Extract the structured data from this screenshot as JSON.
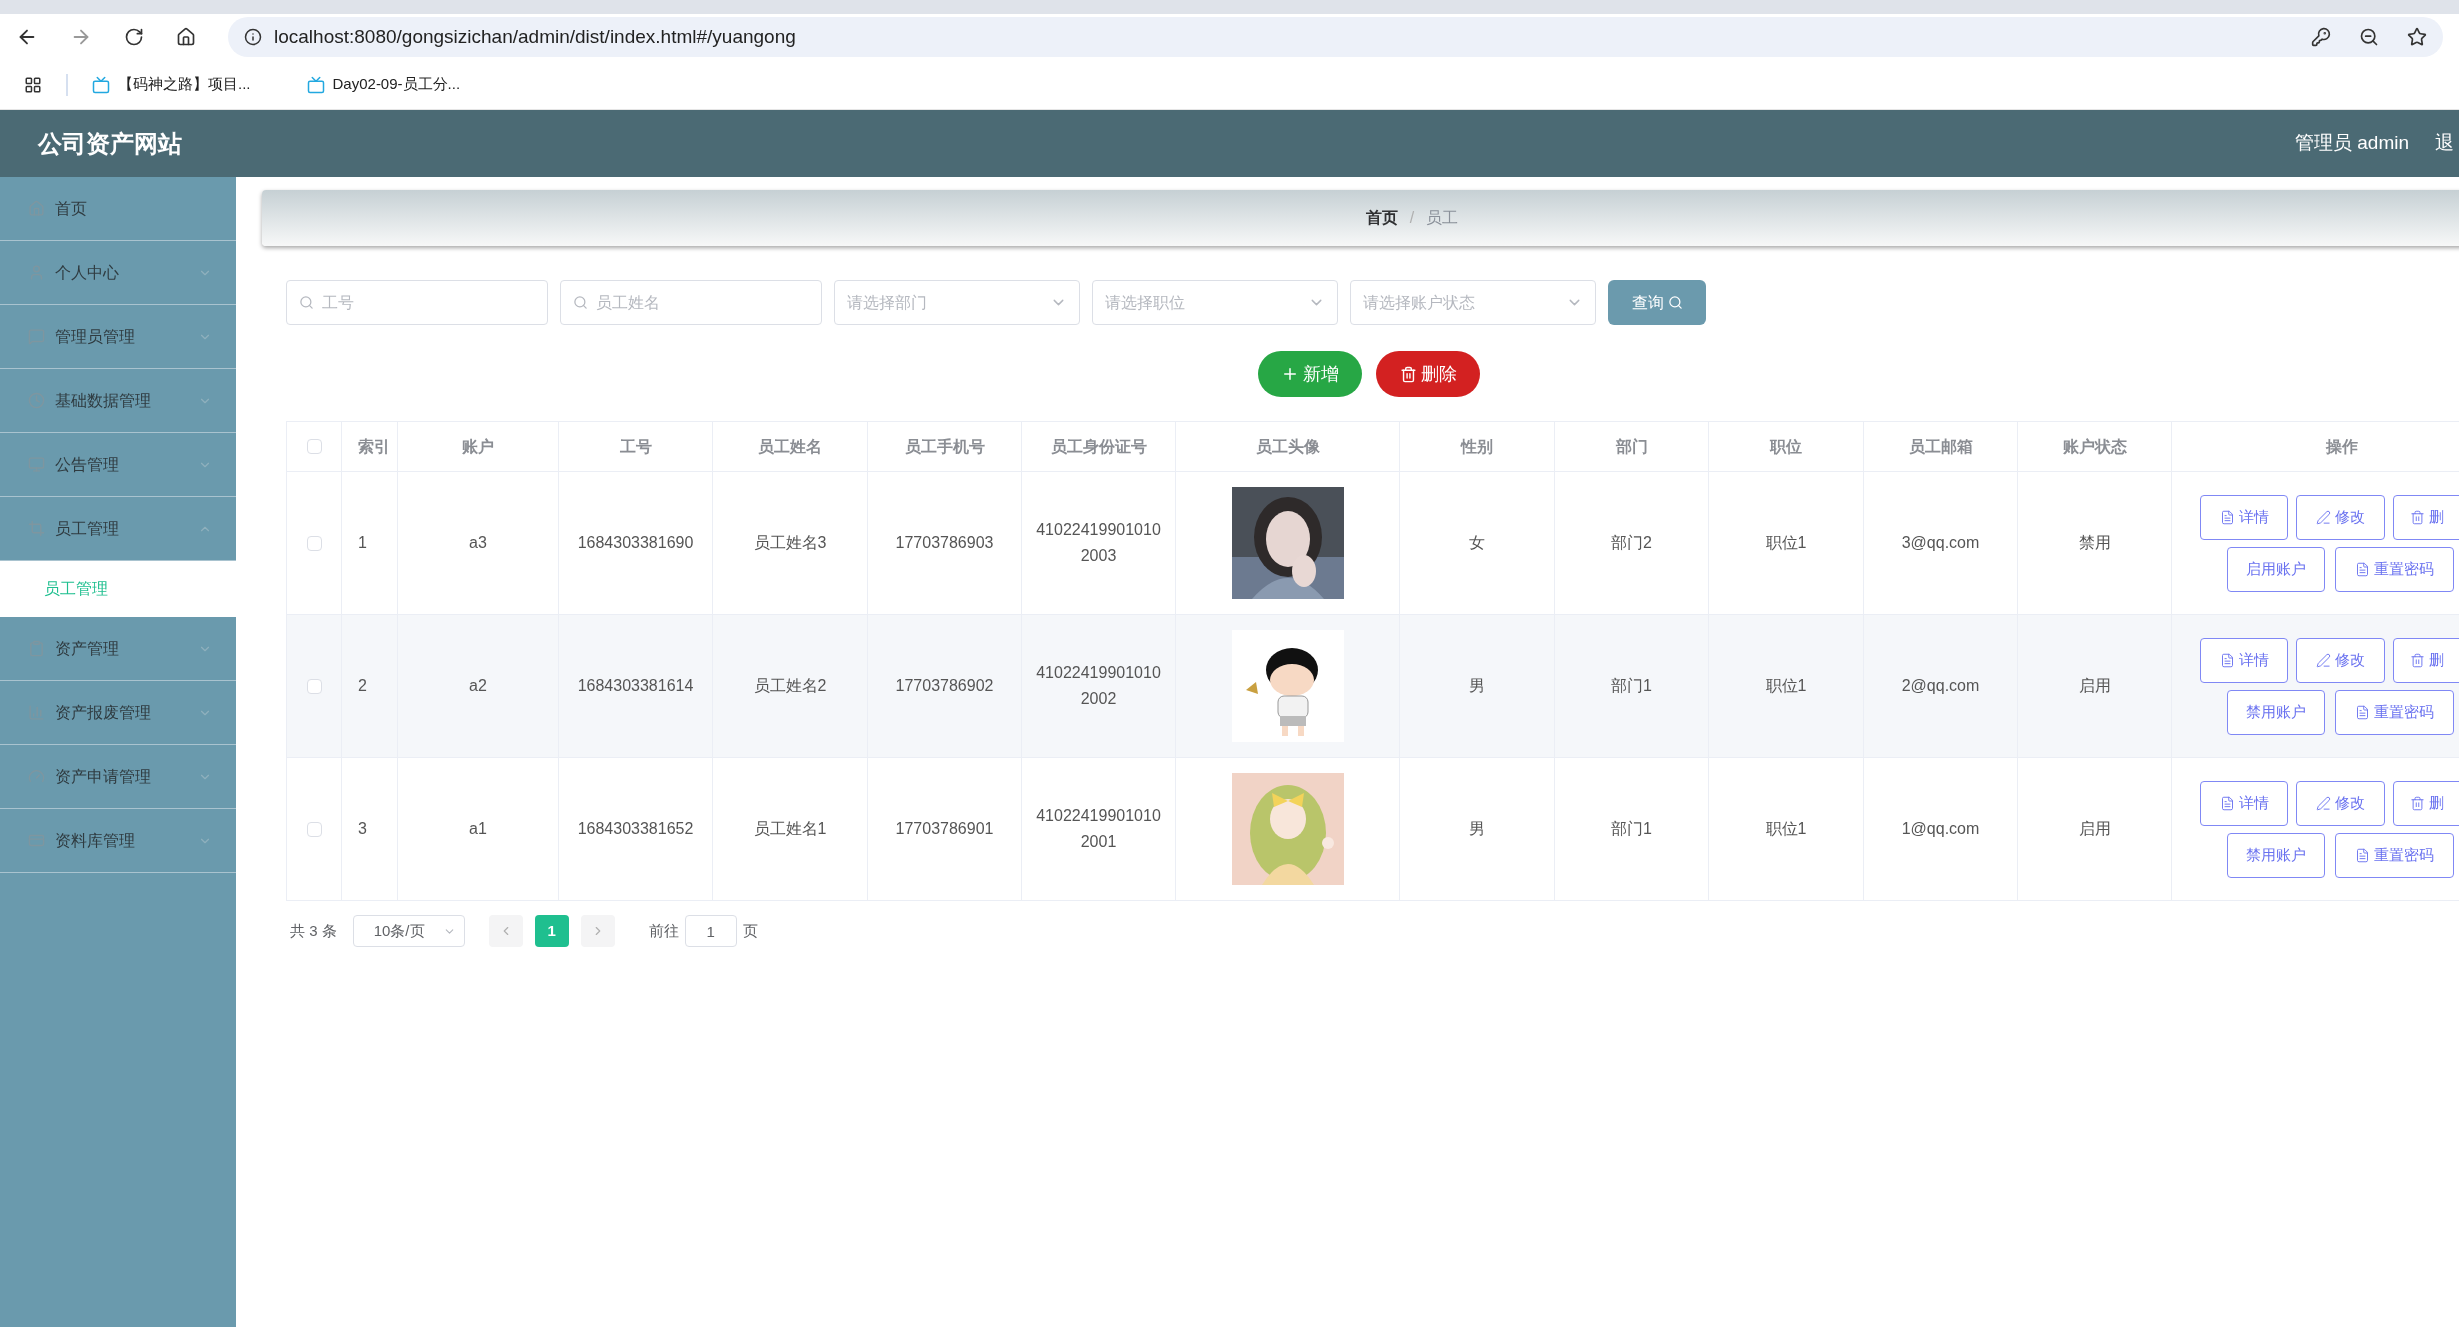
{
  "browser": {
    "url": "localhost:8080/gongsizichan/admin/dist/index.html#/yuangong",
    "bookmarks": [
      "【码神之路】项目...",
      "Day02-09-员工分..."
    ]
  },
  "header": {
    "title": "公司资产网站",
    "user": "管理员 admin",
    "logout": "退"
  },
  "sidebar": {
    "items": [
      {
        "label": "首页",
        "kind": "link"
      },
      {
        "label": "个人中心",
        "kind": "menu",
        "expanded": false
      },
      {
        "label": "管理员管理",
        "kind": "menu",
        "expanded": false
      },
      {
        "label": "基础数据管理",
        "kind": "menu",
        "expanded": false
      },
      {
        "label": "公告管理",
        "kind": "menu",
        "expanded": false
      },
      {
        "label": "员工管理",
        "kind": "menu",
        "expanded": true,
        "children": [
          {
            "label": "员工管理",
            "selected": true
          }
        ]
      },
      {
        "label": "资产管理",
        "kind": "menu",
        "expanded": false
      },
      {
        "label": "资产报废管理",
        "kind": "menu",
        "expanded": false
      },
      {
        "label": "资产申请管理",
        "kind": "menu",
        "expanded": false
      },
      {
        "label": "资料库管理",
        "kind": "menu",
        "expanded": false
      }
    ]
  },
  "breadcrumb": {
    "items": [
      "首页",
      "员工"
    ],
    "separator": "/"
  },
  "filters": [
    {
      "kind": "search",
      "placeholder": "工号"
    },
    {
      "kind": "search",
      "placeholder": "员工姓名"
    },
    {
      "kind": "select",
      "placeholder": "请选择部门"
    },
    {
      "kind": "select",
      "placeholder": "请选择职位"
    },
    {
      "kind": "select",
      "placeholder": "请选择账户状态"
    }
  ],
  "query_button": "查询",
  "actions": [
    {
      "kind": "add",
      "label": "新增"
    },
    {
      "kind": "delete",
      "label": "删除"
    }
  ],
  "table": {
    "header_checked": false,
    "columns": [
      "索引",
      "账户",
      "工号",
      "员工姓名",
      "员工手机号",
      "员工身份证号",
      "员工头像",
      "性别",
      "部门",
      "职位",
      "员工邮箱",
      "账户状态",
      "操作"
    ],
    "rows": [
      {
        "checked": false,
        "index": "1",
        "account": "a3",
        "number": "1684303381690",
        "name": "员工姓名3",
        "phone": "17703786903",
        "id_card": [
          "41022419901010",
          "2003"
        ],
        "gender": "女",
        "department": "部门2",
        "position": "职位1",
        "email": "3@qq.com",
        "status": "禁用",
        "ops": [
          {
            "kind": "detail",
            "label": "详情"
          },
          {
            "kind": "edit",
            "label": "修改"
          },
          {
            "kind": "delete",
            "label": "删"
          },
          {
            "kind": "toggle",
            "label": "启用账户"
          },
          {
            "kind": "reset",
            "label": "重置密码"
          }
        ]
      },
      {
        "checked": false,
        "index": "2",
        "account": "a2",
        "number": "1684303381614",
        "name": "员工姓名2",
        "phone": "17703786902",
        "id_card": [
          "41022419901010",
          "2002"
        ],
        "gender": "男",
        "department": "部门1",
        "position": "职位1",
        "email": "2@qq.com",
        "status": "启用",
        "ops": [
          {
            "kind": "detail",
            "label": "详情"
          },
          {
            "kind": "edit",
            "label": "修改"
          },
          {
            "kind": "delete",
            "label": "删"
          },
          {
            "kind": "toggle",
            "label": "禁用账户"
          },
          {
            "kind": "reset",
            "label": "重置密码"
          }
        ]
      },
      {
        "checked": false,
        "index": "3",
        "account": "a1",
        "number": "1684303381652",
        "name": "员工姓名1",
        "phone": "17703786901",
        "id_card": [
          "41022419901010",
          "2001"
        ],
        "gender": "男",
        "department": "部门1",
        "position": "职位1",
        "email": "1@qq.com",
        "status": "启用",
        "ops": [
          {
            "kind": "detail",
            "label": "详情"
          },
          {
            "kind": "edit",
            "label": "修改"
          },
          {
            "kind": "delete",
            "label": "删"
          },
          {
            "kind": "toggle",
            "label": "禁用账户"
          },
          {
            "kind": "reset",
            "label": "重置密码"
          }
        ]
      }
    ]
  },
  "pagination": {
    "total": "共 3 条",
    "page_size": "10条/页",
    "pages": [
      {
        "label": "1",
        "selected": true
      }
    ],
    "goto_label": "前往",
    "goto_value": "1",
    "goto_suffix": "页"
  }
}
